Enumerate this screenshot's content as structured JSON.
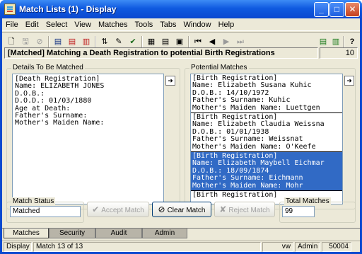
{
  "window": {
    "title": "Match Lists (1) - Display",
    "min": "_",
    "max": "□",
    "close": "✕"
  },
  "menu": [
    "File",
    "Edit",
    "Select",
    "View",
    "Matches",
    "Tools",
    "Tabs",
    "Window",
    "Help"
  ],
  "toolbar_icons": [
    "new-icon",
    "save-icon",
    "stop-icon",
    "doc-a-icon",
    "doc-b-icon",
    "doc-c-icon",
    "sort-icon",
    "edit-icon",
    "spellcheck-icon",
    "print-preview-icon",
    "print-icon",
    "report-icon",
    "first-record-icon",
    "prev-record-icon",
    "next-record-icon",
    "last-record-icon",
    "export-icon",
    "copy-icon",
    "help-icon"
  ],
  "header": {
    "text": "[Matched] Matching a Death Registration to potential Birth Registrations",
    "count": "10"
  },
  "details": {
    "label": "Details To Be Matched",
    "text": "[Death Registration]\nName: ELIZABETH JONES\nD.O.B.:\nD.O.D.: 01/03/1880\nAge at Death:\nFather's Surname:\nMother's Maiden Name:"
  },
  "potential": {
    "label": "Potential Matches",
    "records": [
      "[Birth Registration]\nName: Elizabeth Susana Kuhic\nD.O.B.: 14/10/1972\nFather's Surname: Kuhic\nMother's Maiden Name: Luettgen",
      "[Birth Registration]\nName: Elizabeth Claudia Weissna\nD.O.B.: 01/01/1938\nFather's Surname: Weissnat\nMother's Maiden Name: O'Keefe",
      "[Birth Registration]\nName: Elizabeth Maybell Eichmar\nD.O.B.: 18/09/1874\nFather's Surname: Eichmann\nMother's Maiden Name: Mohr",
      "[Birth Registration]"
    ]
  },
  "match_status": {
    "label": "Match Status",
    "value": "Matched"
  },
  "buttons": {
    "accept": "Accept Match",
    "clear": "Clear Match",
    "reject": "Reject Match"
  },
  "total": {
    "label": "Total Matches",
    "value": "99"
  },
  "tabs": [
    "Matches",
    "Security",
    "Audit",
    "Admin"
  ],
  "status": {
    "mode": "Display",
    "match": "Match 13 of 13",
    "user": "vw",
    "role": "Admin",
    "code": "50004"
  }
}
